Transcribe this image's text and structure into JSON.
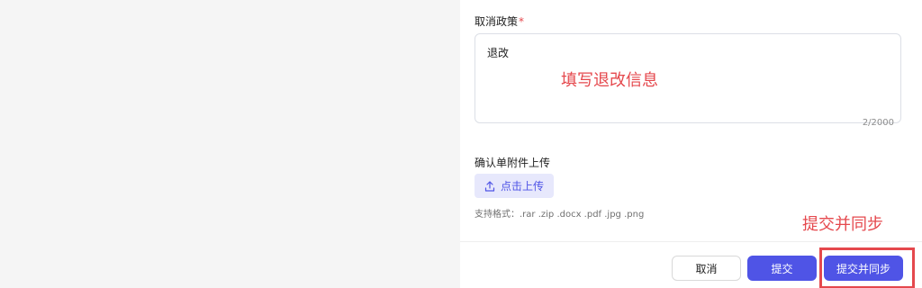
{
  "form": {
    "cancel_policy": {
      "label": "取消政策",
      "required_mark": "*",
      "value": "退改",
      "counter": "2/2000"
    },
    "attachment": {
      "label": "确认单附件上传",
      "upload_button_label": "点击上传",
      "upload_icon": "upload-icon",
      "supported_formats": "支持格式：.rar .zip .docx .pdf .jpg .png"
    }
  },
  "annotations": {
    "fill_hint": "填写退改信息",
    "submit_sync_hint": "提交并同步"
  },
  "footer": {
    "cancel_label": "取消",
    "submit_label": "提交",
    "submit_sync_label": "提交并同步"
  },
  "colors": {
    "primary": "#4f54e6",
    "annotation": "#e5484d",
    "upload_bg": "#e7e8fc"
  }
}
